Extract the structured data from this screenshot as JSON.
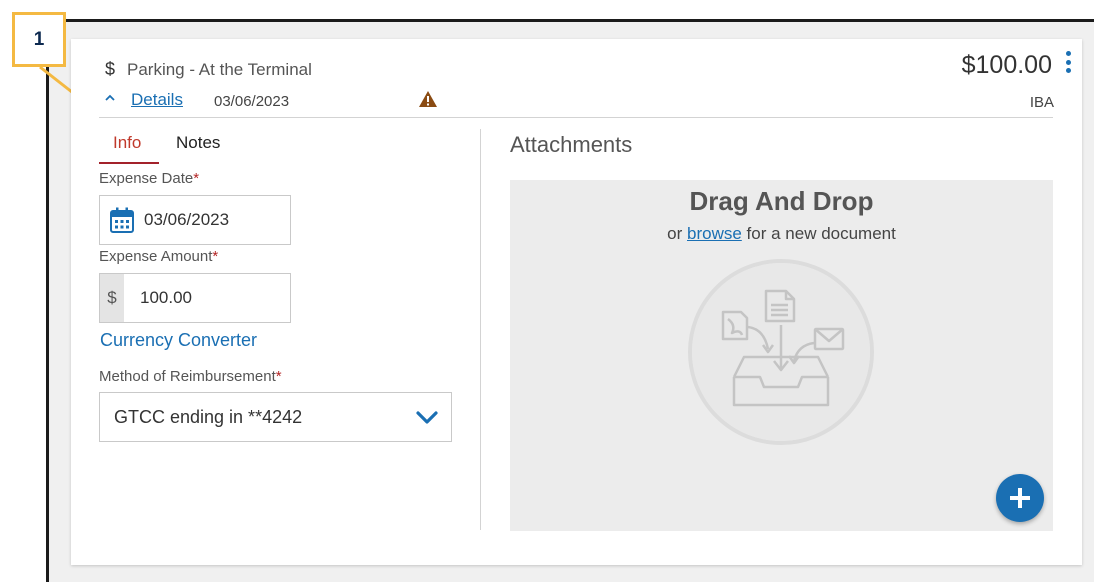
{
  "callout": {
    "number": "1"
  },
  "expense": {
    "currency_icon": "dollar-icon",
    "title": "Parking - At the Terminal",
    "amount": "$100.00",
    "details_label": "Details",
    "date": "03/06/2023",
    "code": "IBA",
    "warning_icon": "warning-icon"
  },
  "tabs": [
    {
      "label": "Info",
      "active": true
    },
    {
      "label": "Notes",
      "active": false
    }
  ],
  "form": {
    "expense_date_label": "Expense Date",
    "expense_date_value": "03/06/2023",
    "expense_amount_label": "Expense Amount",
    "currency_prefix": "$",
    "expense_amount_value": "100.00",
    "currency_converter_label": "Currency Converter",
    "reimbursement_label": "Method of Reimbursement",
    "reimbursement_value": "GTCC ending in **4242",
    "required_marker": "*"
  },
  "attachments": {
    "title": "Attachments",
    "drop_title": "Drag And Drop",
    "drop_prefix": "or",
    "browse_label": "browse",
    "drop_suffix": "for a new document"
  },
  "colors": {
    "accent": "#1a6fb3",
    "tab_active": "#c0392b",
    "required": "#b32424",
    "warning": "#8a4b12",
    "callout_border": "#f4b942"
  }
}
